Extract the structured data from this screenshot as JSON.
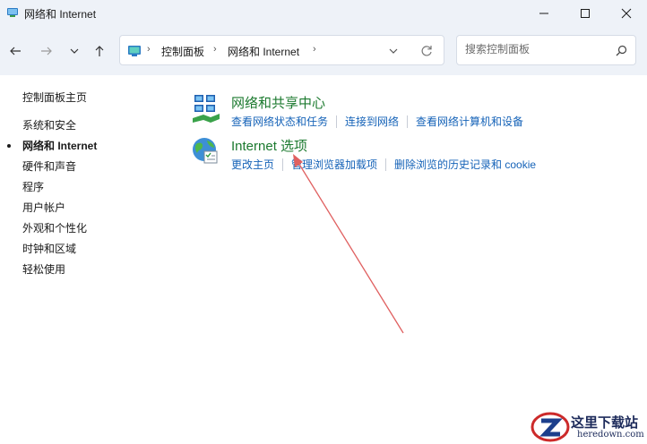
{
  "window": {
    "title": "网络和 Internet"
  },
  "address": {
    "crumbs": [
      "控制面板",
      "网络和 Internet"
    ],
    "separator": "›"
  },
  "search": {
    "placeholder": "搜索控制面板"
  },
  "leftnav": {
    "home": "控制面板主页",
    "items": [
      {
        "label": "系统和安全",
        "active": false
      },
      {
        "label": "网络和 Internet",
        "active": true
      },
      {
        "label": "硬件和声音",
        "active": false
      },
      {
        "label": "程序",
        "active": false
      },
      {
        "label": "用户帐户",
        "active": false
      },
      {
        "label": "外观和个性化",
        "active": false
      },
      {
        "label": "时钟和区域",
        "active": false
      },
      {
        "label": "轻松使用",
        "active": false
      }
    ]
  },
  "categories": [
    {
      "title": "网络和共享中心",
      "icon": "network-sharing-center-icon",
      "links": [
        "查看网络状态和任务",
        "连接到网络",
        "查看网络计算机和设备"
      ]
    },
    {
      "title": "Internet 选项",
      "icon": "internet-options-globe-icon",
      "links": [
        "更改主页",
        "管理浏览器加载项",
        "删除浏览的历史记录和 cookie"
      ]
    }
  ],
  "annotation": {
    "arrow_color": "#e06060"
  },
  "watermark": {
    "title": "这里下载站",
    "subtitle": "heredown.com"
  }
}
